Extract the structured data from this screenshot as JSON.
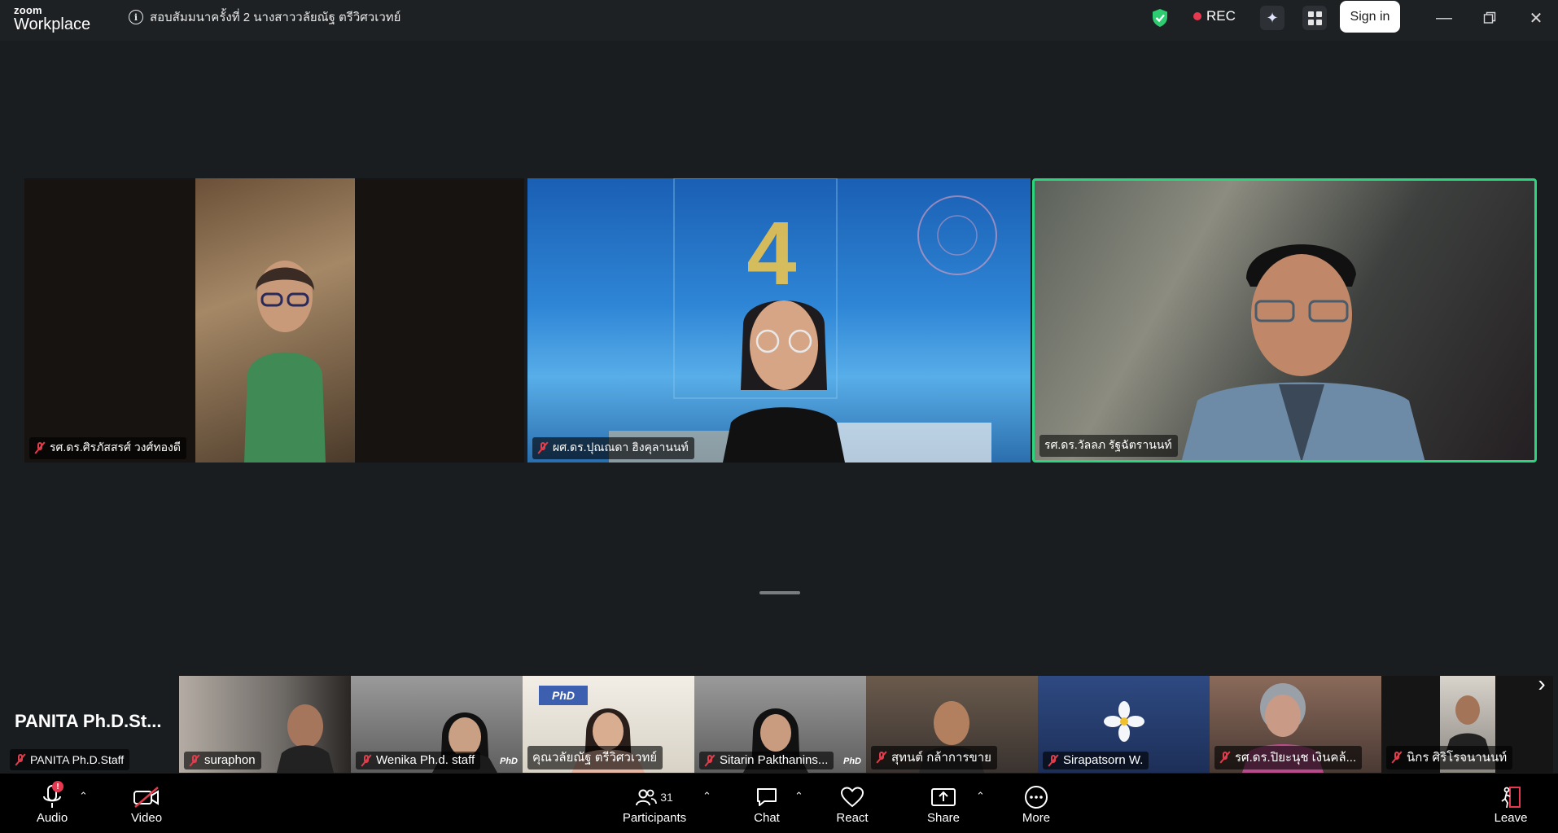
{
  "app": {
    "brand_small": "zoom",
    "brand_large": "Workplace"
  },
  "meeting": {
    "title": "สอบสัมมนาครั้งที่ 2  นางสาววลัยณัฐ ตรีวิศวเวทย์"
  },
  "titlebar": {
    "rec_label": "REC",
    "sign_in_label": "Sign in"
  },
  "main_tiles": [
    {
      "name": "รศ.ดร.ศิรภัสสรศ์  วงศ์ทองดี",
      "muted": true,
      "active": false
    },
    {
      "name": "ผศ.ดร.ปุณณดา ฮิงคุลานนท์",
      "muted": true,
      "active": false
    },
    {
      "name": "รศ.ดร.วัลลภ รัฐฉัตรานนท์",
      "muted": false,
      "active": true
    }
  ],
  "self_view": {
    "display_name": "PANITA  Ph.D.St...",
    "tag": "PANITA Ph.D.Staff",
    "muted": true
  },
  "strip": [
    {
      "name": "suraphon",
      "muted": true
    },
    {
      "name": "Wenika Ph.d. staff",
      "muted": true,
      "mark": "PhD"
    },
    {
      "name": "คุณวลัยณัฐ  ตรีวิศวเวทย์",
      "muted": false
    },
    {
      "name": "Sitarin Pakthanins...",
      "muted": true,
      "mark": "PhD"
    },
    {
      "name": "สุทนต์ กล้าการขาย",
      "muted": true
    },
    {
      "name": "Sirapatsorn W.",
      "muted": true
    },
    {
      "name": "รศ.ดร.ปิยะนุช  เงินคล้...",
      "muted": true
    },
    {
      "name": "นิกร ศิริโรจนานนท์",
      "muted": true
    }
  ],
  "toolbar": {
    "audio_label": "Audio",
    "audio_badge": "!",
    "video_label": "Video",
    "participants_label": "Participants",
    "participants_count": "31",
    "chat_label": "Chat",
    "react_label": "React",
    "share_label": "Share",
    "more_label": "More",
    "leave_label": "Leave"
  },
  "colors": {
    "active_speaker": "#2bd47d",
    "rec": "#e8384f",
    "muted": "#e03e4c",
    "shield": "#2ecc71"
  }
}
